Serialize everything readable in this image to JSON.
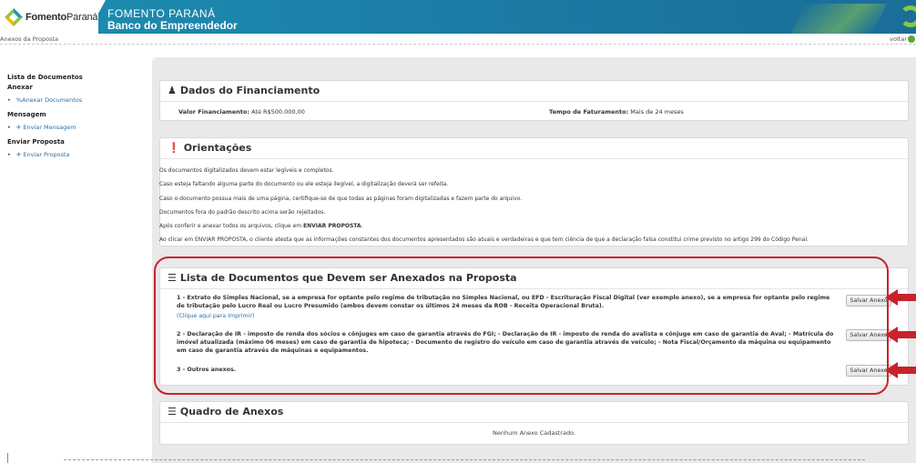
{
  "header": {
    "logo_text_bold": "Fomento",
    "logo_text_rest": "Paraná",
    "brand_line1": "FOMENTO PARANÁ",
    "brand_line2": "Banco do Empreendedor"
  },
  "breadcrumb": "Anexos da Proposta",
  "back_label": "voltar",
  "sidebar": {
    "section1_title": "Lista de Documentos",
    "section1_sub": "Anexar",
    "attach_item": "%Anexar Documentos",
    "section2_title": "Mensagem",
    "message_item": "Enviar Mensagem",
    "section3_title": "Enviar Proposta",
    "proposal_item": "Enviar Proposta"
  },
  "financing": {
    "title": "Dados do Financiamento",
    "amount_label": "Valor Financiamento:",
    "amount_value": "Até R$500.000,00",
    "billing_label": "Tempo de Faturamento:",
    "billing_value": "Mais de 24 meses"
  },
  "guidelines": {
    "title": "Orientações",
    "lines": [
      "Os documentos digitalizados devem estar legíveis e completos.",
      "Caso esteja faltando alguma parte do documento ou ele esteja ilegível, a digitalização deverá ser refeita.",
      "Caso o documento possua mais de uma página, certifique-se de que todas as páginas foram digitalizadas e fazem parte do arquivo.",
      "Documentos fora do padrão descrito acima serão rejeitados.",
      "Ao clicar em ENVIAR PROPOSTA, o cliente atesta que as informações constantes dos documentos apresentados são atuais e verdadeiras e que tem ciência de que a declaração falsa constitui crime previsto no artigo 299 do Código Penal."
    ],
    "line5_prefix": "Após conferir e anexar todos os arquivos, clique em ",
    "line5_bold": "ENVIAR PROPOSTA",
    "line5_suffix": "."
  },
  "documents": {
    "title": "Lista de Documentos que Devem ser Anexados na Proposta",
    "items": [
      {
        "text": "1 - Extrato do Simples Nacional, se a empresa for optante pelo regime de tributação no Simples Nacional, ou EFD - Escrituração Fiscal Digital (ver exemplo anexo), se a empresa for optante pelo regime de tributação pelo Lucro Real ou Lucro Presumido (ambos devem constar os últimos 24 meses da ROB - Receita Operacional Bruta).",
        "link": "(Clique aqui para Imprimir)",
        "button": "Salvar Anexo"
      },
      {
        "text": "2 - Declaração de IR - imposto de renda dos sócios e cônjuges em caso de garantia através do FGI; - Declaração de IR - imposto de renda do avalista e cônjuge em caso de garantia de Aval; - Matrícula do imóvel atualizada (máximo 06 meses) em caso de garantia de hipoteca; - Documento de registro do veículo em caso de garantia através de veículo; - Nota Fiscal/Orçamento da máquina ou equipamento em caso de garantia através de máquinas e equipamentos.",
        "button": "Salvar Anexo"
      },
      {
        "text": "3 - Outros anexos.",
        "button": "Salvar Anexo"
      }
    ]
  },
  "attachments": {
    "title": "Quadro de Anexos",
    "empty_message": "Nenhum Anexo Cadastrado."
  },
  "icons": {
    "user": "user-icon",
    "info": "info-circle-icon",
    "list": "list-icon",
    "paperclip": "paperclip-icon",
    "send": "send-icon",
    "arrow": "red-arrow-icon"
  },
  "colors": {
    "header": "#1c7fa8",
    "highlight": "#c8232c",
    "link": "#2b6fa6",
    "panel_bg": "#e9e9e9"
  }
}
